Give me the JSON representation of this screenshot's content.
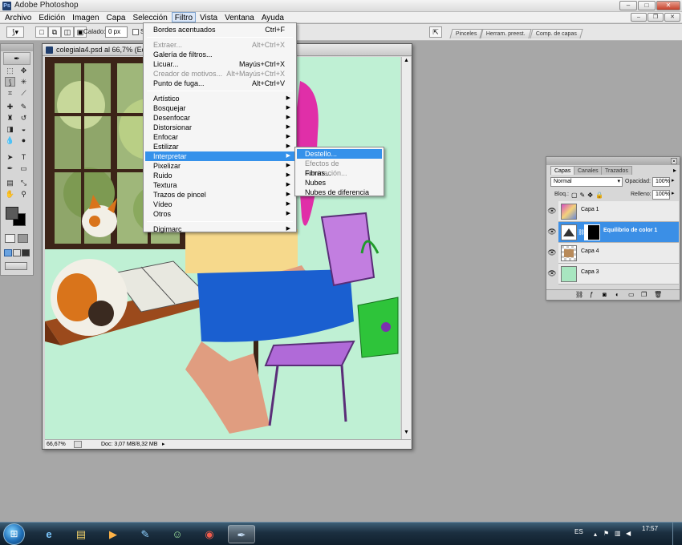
{
  "app": {
    "title": "Adobe Photoshop"
  },
  "menubar": [
    "Archivo",
    "Edición",
    "Imagen",
    "Capa",
    "Selección",
    "Filtro",
    "Vista",
    "Ventana",
    "Ayuda"
  ],
  "options_bar": {
    "feather_label": "Calado:",
    "feather_value": "0 px",
    "checkbox_label": "Se"
  },
  "panel_well_tabs": [
    "Pinceles",
    "Herram. preest.",
    "Comp. de capas"
  ],
  "document": {
    "title": "colegiala4.psd al 66,7% (Equili...",
    "zoom": "66,67%",
    "doc_size": "Doc: 3,07 MB/8,32 MB"
  },
  "filter_menu": [
    {
      "label": "Bordes acentuados",
      "shortcut": "Ctrl+F",
      "disabled": false,
      "submenu": false
    },
    {
      "sep": true
    },
    {
      "label": "Extraer...",
      "shortcut": "Alt+Ctrl+X",
      "disabled": true,
      "submenu": false
    },
    {
      "label": "Galería de filtros...",
      "shortcut": "",
      "disabled": false,
      "submenu": false
    },
    {
      "label": "Licuar...",
      "shortcut": "Mayús+Ctrl+X",
      "disabled": false,
      "submenu": false
    },
    {
      "label": "Creador de motivos...",
      "shortcut": "Alt+Mayús+Ctrl+X",
      "disabled": true,
      "submenu": false
    },
    {
      "label": "Punto de fuga...",
      "shortcut": "Alt+Ctrl+V",
      "disabled": false,
      "submenu": false
    },
    {
      "sep": true
    },
    {
      "label": "Artístico",
      "submenu": true
    },
    {
      "label": "Bosquejar",
      "submenu": true
    },
    {
      "label": "Desenfocar",
      "submenu": true
    },
    {
      "label": "Distorsionar",
      "submenu": true
    },
    {
      "label": "Enfocar",
      "submenu": true
    },
    {
      "label": "Estilizar",
      "submenu": true
    },
    {
      "label": "Interpretar",
      "submenu": true,
      "highlighted": true
    },
    {
      "label": "Pixelizar",
      "submenu": true
    },
    {
      "label": "Ruido",
      "submenu": true
    },
    {
      "label": "Textura",
      "submenu": true
    },
    {
      "label": "Trazos de pincel",
      "submenu": true
    },
    {
      "label": "Vídeo",
      "submenu": true
    },
    {
      "label": "Otros",
      "submenu": true
    },
    {
      "sep": true
    },
    {
      "label": "Digimarc",
      "submenu": true
    }
  ],
  "interpretar_submenu": [
    {
      "label": "Destello...",
      "disabled": false,
      "highlighted": true
    },
    {
      "label": "Efectos de iluminación...",
      "disabled": true
    },
    {
      "label": "Fibras...",
      "disabled": false
    },
    {
      "label": "Nubes",
      "disabled": false
    },
    {
      "label": "Nubes de diferencia",
      "disabled": false
    }
  ],
  "layers_panel": {
    "tabs": [
      "Capas",
      "Canales",
      "Trazados"
    ],
    "blend_mode": "Normal",
    "opacity_label": "Opacidad:",
    "opacity": "100%",
    "lock_label": "Bloq.:",
    "fill_label": "Relleno:",
    "fill": "100%",
    "layers": [
      {
        "name": "Capa 1",
        "selected": false
      },
      {
        "name": "Equilibrio de color 1",
        "selected": true
      },
      {
        "name": "Capa 4",
        "selected": false
      },
      {
        "name": "Capa 3",
        "selected": false
      }
    ]
  },
  "taskbar": {
    "language": "ES",
    "time": "17:57"
  },
  "colors": {
    "accent": "#3591ea",
    "canvas_bg": "#bff0d4",
    "skirt": "#1a5fd0",
    "bag": "#2ec43a",
    "chair": "#b06ad8"
  }
}
